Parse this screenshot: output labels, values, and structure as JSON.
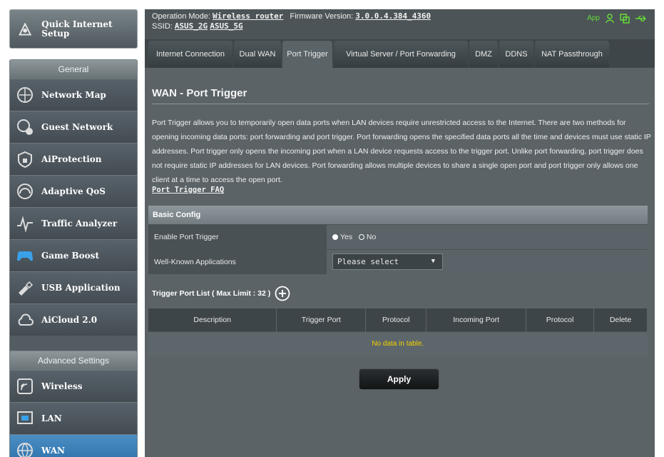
{
  "sidebar": {
    "quick_setup": "Quick Internet Setup",
    "general_title": "General",
    "general_items": [
      {
        "label": "Network Map",
        "icon": "network-map-icon"
      },
      {
        "label": "Guest Network",
        "icon": "guest-network-icon"
      },
      {
        "label": "AiProtection",
        "icon": "aiprotection-icon"
      },
      {
        "label": "Adaptive QoS",
        "icon": "adaptive-qos-icon"
      },
      {
        "label": "Traffic Analyzer",
        "icon": "traffic-analyzer-icon"
      },
      {
        "label": "Game Boost",
        "icon": "game-boost-icon"
      },
      {
        "label": "USB Application",
        "icon": "usb-application-icon"
      },
      {
        "label": "AiCloud 2.0",
        "icon": "aicloud-icon"
      }
    ],
    "advanced_title": "Advanced Settings",
    "advanced_items": [
      {
        "label": "Wireless",
        "icon": "wireless-icon"
      },
      {
        "label": "LAN",
        "icon": "lan-icon"
      },
      {
        "label": "WAN",
        "icon": "wan-icon",
        "active": true
      }
    ]
  },
  "header": {
    "mode_label": "Operation Mode:",
    "mode_value": "Wireless router",
    "fw_label": "Firmware Version:",
    "fw_value": "3.0.0.4.384_4360",
    "ssid_label": "SSID:",
    "ssid_1": "ASUS_2G",
    "ssid_2": "ASUS_5G",
    "app_label": "App"
  },
  "tabs": [
    {
      "label": "Internet Connection"
    },
    {
      "label": "Dual WAN"
    },
    {
      "label": "Port Trigger",
      "active": true
    },
    {
      "label": "Virtual Server / Port Forwarding"
    },
    {
      "label": "DMZ"
    },
    {
      "label": "DDNS"
    },
    {
      "label": "NAT Passthrough"
    }
  ],
  "page": {
    "title": "WAN - Port Trigger",
    "description": "Port Trigger allows you to temporarily open data ports when LAN devices require unrestricted access to the Internet. There are two methods for opening incoming data ports: port forwarding and port trigger. Port forwarding opens the specified data ports all the time and devices must use static IP addresses. Port trigger only opens the incoming port when a LAN device requests access to the trigger port. Unlike port forwarding, port trigger does not require static IP addresses for LAN devices. Port forwarding allows multiple devices to share a single open port and port trigger only allows one client at a time to access the open port.",
    "faq_link": "Port Trigger FAQ"
  },
  "basic_config": {
    "header": "Basic Config",
    "enable_label": "Enable Port Trigger",
    "yes": "Yes",
    "no": "No",
    "selected": "yes",
    "apps_label": "Well-Known Applications",
    "apps_value": "Please select"
  },
  "trigger_list": {
    "title": "Trigger Port List ( Max Limit : 32 )",
    "columns": [
      "Description",
      "Trigger Port",
      "Protocol",
      "Incoming Port",
      "Protocol",
      "Delete"
    ],
    "empty": "No data in table."
  },
  "apply_label": "Apply"
}
